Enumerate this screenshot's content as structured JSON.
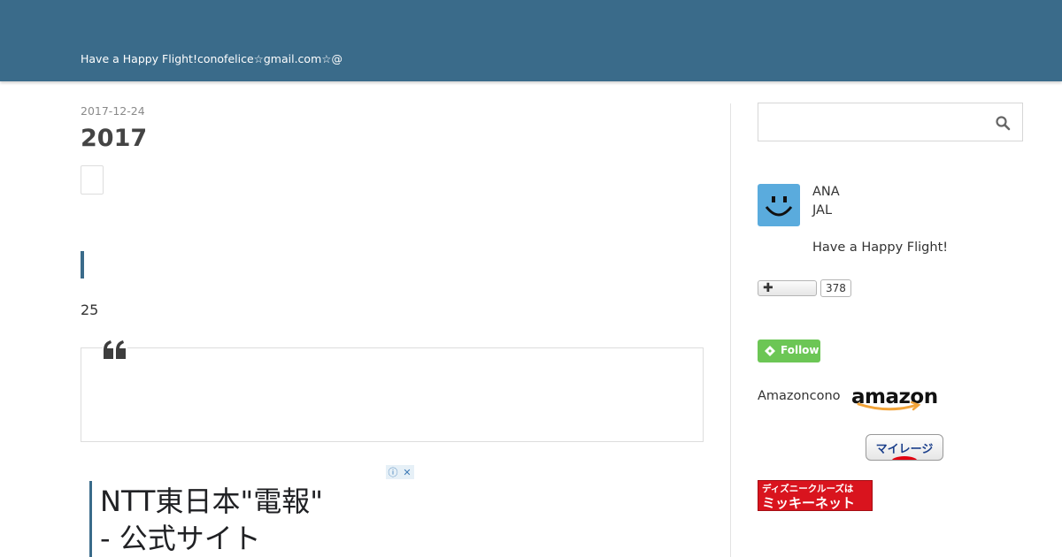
{
  "header": {
    "tagline": "Have a Happy Flight!conofelice☆gmail.com☆@",
    "background_color": "#3a6b8a"
  },
  "post": {
    "date": "2017-12-24",
    "title": "2017",
    "body_number": "25",
    "accent_color": "#3a6b8a"
  },
  "ad": {
    "title_line1": "NTT東日本\"電報\"",
    "title_line2": "- 公式サイト",
    "info_icon": "info-icon",
    "close_icon": "close-icon"
  },
  "sidebar": {
    "search": {
      "placeholder": "",
      "icon": "search-icon"
    },
    "profile": {
      "avatar_icon": "smiley-face-icon",
      "avatar_color": "#5aabdd",
      "line1": "ANA",
      "line2": "JAL",
      "line3": "Have a Happy Flight!"
    },
    "follow": {
      "count": "378"
    },
    "feedly": {
      "label": "Follow",
      "color": "#6cc655"
    },
    "amazon": {
      "text": "Amazoncono",
      "logo_text": "amazon"
    },
    "mileage": {
      "label": "マイレージ"
    },
    "disney": {
      "line1": "ディズニークルーズは",
      "line2": "ミッキーネット",
      "color": "#d9141e"
    }
  }
}
